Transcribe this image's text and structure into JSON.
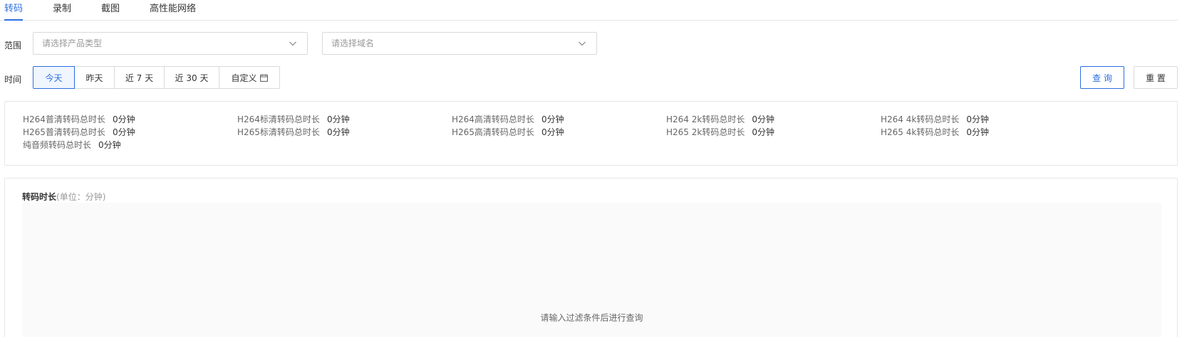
{
  "tabs": [
    {
      "label": "转码",
      "active": true
    },
    {
      "label": "录制",
      "active": false
    },
    {
      "label": "截图",
      "active": false
    },
    {
      "label": "高性能网络",
      "active": false
    }
  ],
  "filters": {
    "scope_label": "范围",
    "product_type_placeholder": "请选择产品类型",
    "domain_placeholder": "请选择域名",
    "time_label": "时间",
    "time_options": [
      {
        "label": "今天",
        "active": true
      },
      {
        "label": "昨天",
        "active": false
      },
      {
        "label": "近 7 天",
        "active": false
      },
      {
        "label": "近 30 天",
        "active": false
      },
      {
        "label": "自定义",
        "active": false
      }
    ],
    "query_label": "查 询",
    "reset_label": "重 置"
  },
  "stats": [
    {
      "label": "H264普清转码总时长",
      "value": "0分钟"
    },
    {
      "label": "H264标清转码总时长",
      "value": "0分钟"
    },
    {
      "label": "H264高清转码总时长",
      "value": "0分钟"
    },
    {
      "label": "H264 2k转码总时长",
      "value": "0分钟"
    },
    {
      "label": "H264 4k转码总时长",
      "value": "0分钟"
    },
    {
      "label": "H265普清转码总时长",
      "value": "0分钟"
    },
    {
      "label": "H265标清转码总时长",
      "value": "0分钟"
    },
    {
      "label": "H265高清转码总时长",
      "value": "0分钟"
    },
    {
      "label": "H265 2k转码总时长",
      "value": "0分钟"
    },
    {
      "label": "H265 4k转码总时长",
      "value": "0分钟"
    },
    {
      "label": "纯音频转码总时长",
      "value": "0分钟"
    }
  ],
  "panel": {
    "title": "转码时长",
    "unit": "(单位：分钟)",
    "empty_message": "请输入过滤条件后进行查询"
  },
  "colors": {
    "accent": "#2c6ee0",
    "border": "#d9d9d9",
    "chart_bg": "#fafafa"
  },
  "icons": {
    "select_arrow": "chevron-down-icon",
    "custom_date": "calendar-icon"
  }
}
